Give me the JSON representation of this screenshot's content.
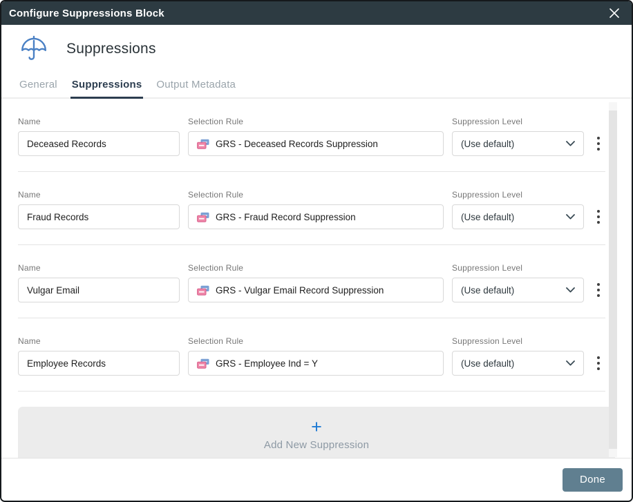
{
  "dialog": {
    "title": "Configure Suppressions Block",
    "heading": "Suppressions",
    "done_label": "Done"
  },
  "tabs": [
    {
      "label": "General",
      "active": false
    },
    {
      "label": "Suppressions",
      "active": true
    },
    {
      "label": "Output Metadata",
      "active": false
    }
  ],
  "fields": {
    "name_label": "Name",
    "rule_label": "Selection Rule",
    "level_label": "Suppression Level"
  },
  "rows": [
    {
      "name": "Deceased Records",
      "rule": "GRS - Deceased Records Suppression",
      "level": "(Use default)"
    },
    {
      "name": "Fraud Records",
      "rule": "GRS - Fraud Record Suppression",
      "level": "(Use default)"
    },
    {
      "name": "Vulgar Email",
      "rule": "GRS - Vulgar Email Record Suppression",
      "level": "(Use default)"
    },
    {
      "name": "Employee Records",
      "rule": "GRS - Employee Ind = Y",
      "level": "(Use default)"
    }
  ],
  "add_button": {
    "plus": "+",
    "label": "Add New Suppression"
  },
  "icons": {
    "header": "umbrella-icon",
    "rule_field": "rule-cards-icon",
    "row_menu": "kebab-icon",
    "dropdown": "chevron-down-icon",
    "titlebar": "close-icon"
  },
  "colors": {
    "titlebar_bg": "#2d3b42",
    "accent_blue": "#1f7ad4",
    "umbrella_blue": "#4a80c4",
    "rule_icon_pink": "#ee86a8",
    "rule_icon_blue": "#7aa0d4",
    "active_tab": "#2c3d4f",
    "done_button_bg": "#607f90",
    "add_button_bg": "#ececec"
  }
}
